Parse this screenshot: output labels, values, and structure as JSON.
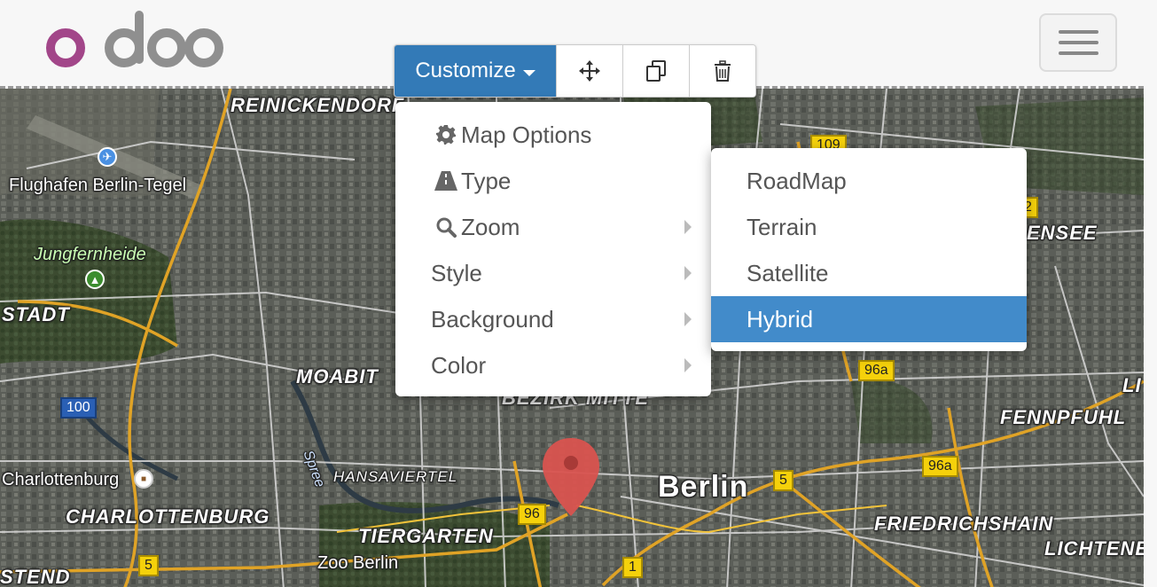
{
  "header": {
    "logo_text": "odoo",
    "menu_toggle_icon": "hamburger-icon"
  },
  "toolbar": {
    "customize_label": "Customize",
    "move_icon": "move-arrows-icon",
    "duplicate_icon": "duplicate-icon",
    "delete_icon": "trash-icon"
  },
  "menu": {
    "items": [
      {
        "label": "Map Options",
        "icon": "gear-icon",
        "has_submenu": false
      },
      {
        "label": "Type",
        "icon": "road-icon",
        "has_submenu": false
      },
      {
        "label": "Zoom",
        "icon": "search-icon",
        "has_submenu": true
      },
      {
        "label": "Style",
        "icon": "",
        "has_submenu": true
      },
      {
        "label": "Background",
        "icon": "",
        "has_submenu": true
      },
      {
        "label": "Color",
        "icon": "",
        "has_submenu": true
      }
    ]
  },
  "submenu": {
    "items": [
      {
        "label": "RoadMap",
        "selected": false
      },
      {
        "label": "Terrain",
        "selected": false
      },
      {
        "label": "Satellite",
        "selected": false
      },
      {
        "label": "Hybrid",
        "selected": true
      }
    ]
  },
  "map": {
    "labels": {
      "reinickendorf": "REINICKENDORF",
      "tegel": "Flughafen Berlin-Tegel",
      "jungfernheide": "Jungfernheide",
      "stadt": "STADT",
      "moabit": "MOABIT",
      "bezirk_mitte": "BEZIRK MITTE",
      "charlottenburg_place": "Charlottenburg",
      "charlottenburg": "CHARLOTTENBURG",
      "hansaviertel": "HANSAVIERTEL",
      "spree": "Spree",
      "tiergarten": "TIERGARTEN",
      "zoo": "Zoo Berlin",
      "stend": "STEND",
      "berlin": "Berlin",
      "friedrichshain": "FRIEDRICHSHAIN",
      "fennpfuhl": "FENNPFUHL",
      "lichtenberg": "LICHTENE",
      "ensee": "ENSEE",
      "li": "LI"
    },
    "shields": {
      "r109": "109",
      "r2": "2",
      "r96a_1": "96a",
      "r96a_2": "96a",
      "r100": "100",
      "r5_east": "5",
      "r96": "96",
      "r5_west": "5",
      "r1": "1"
    },
    "colors": {
      "accent": "#337ab7",
      "selected": "#428bca",
      "pin": "#d9534f"
    }
  }
}
